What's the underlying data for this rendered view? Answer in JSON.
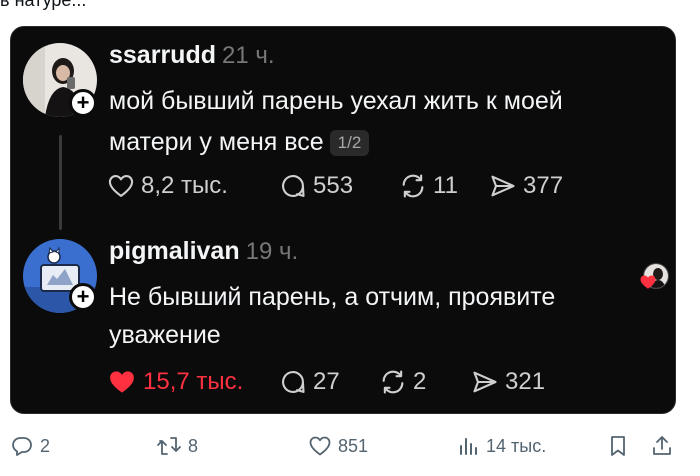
{
  "top_cut_text": "в натуре...",
  "post": {
    "username": "ssarrudd",
    "time": "21 ч.",
    "line1": "мой бывший парень уехал жить к моей",
    "line2": "матери у меня все",
    "pager": "1/2",
    "likes": "8,2 тыс.",
    "comments": "553",
    "reposts": "11",
    "shares": "377"
  },
  "reply": {
    "username": "pigmalivan",
    "time": "19 ч.",
    "line1": "Не бывший парень, а отчим, проявите",
    "line2": "уважение",
    "likes": "15,7 тыс.",
    "comments": "27",
    "reposts": "2",
    "shares": "321"
  },
  "tweet_actions": {
    "replies": "2",
    "retweets": "8",
    "likes": "851",
    "views": "14 тыс."
  },
  "colors": {
    "card_bg": "#0b0b0b",
    "liked_red": "#ff3040",
    "x_gray": "#536471"
  }
}
